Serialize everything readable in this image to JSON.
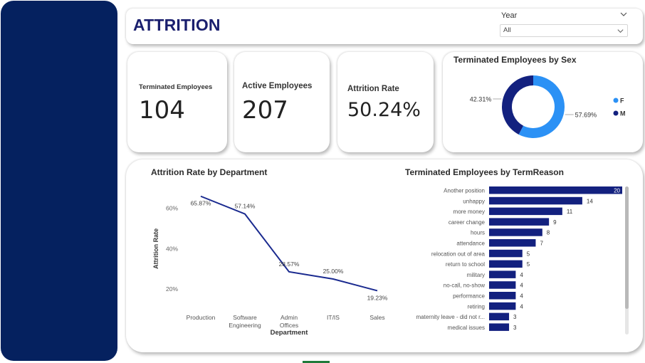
{
  "header": {
    "title": "ATTRITION",
    "slicer_label": "Year",
    "slicer_value": "All"
  },
  "kpis": [
    {
      "label": "Terminated Employees",
      "value": "104"
    },
    {
      "label": "Active Employees",
      "value": "207"
    },
    {
      "label": "Attrition Rate",
      "value": "50.24%"
    }
  ],
  "colors": {
    "sidebar": "#05215f",
    "accent_dark": "#13217f",
    "accent_light": "#2b91f5"
  },
  "chart_data": [
    {
      "type": "pie",
      "title": "Terminated Employees by Sex",
      "categories": [
        "F",
        "M"
      ],
      "values": [
        57.69,
        42.31
      ],
      "labels": [
        "57.69%",
        "42.31%"
      ],
      "colors": [
        "#2b91f5",
        "#13217f"
      ],
      "legend": "right"
    },
    {
      "type": "line",
      "title": "Attrition Rate by Department",
      "xlabel": "Department",
      "ylabel": "Attrition Rate",
      "categories": [
        "Production",
        "Software Engineering",
        "Admin Offices",
        "IT/IS",
        "Sales"
      ],
      "values": [
        65.87,
        57.14,
        28.57,
        25.0,
        19.23
      ],
      "labels": [
        "65.87%",
        "57.14%",
        "28.57%",
        "25.00%",
        "19.23%"
      ],
      "yticks": [
        "20%",
        "40%",
        "60%"
      ],
      "ytick_values": [
        20,
        40,
        60
      ],
      "ylim": [
        12,
        70
      ],
      "grid": false
    },
    {
      "type": "bar",
      "orientation": "horizontal",
      "title": "Terminated Employees by TermReason",
      "categories": [
        "Another position",
        "unhappy",
        "more money",
        "career change",
        "hours",
        "attendance",
        "relocation out of area",
        "return to school",
        "military",
        "no-call, no-show",
        "performance",
        "retiring",
        "maternity leave - did not r...",
        "medical issues"
      ],
      "values": [
        20,
        14,
        11,
        9,
        8,
        7,
        5,
        5,
        4,
        4,
        4,
        4,
        3,
        3
      ],
      "xlim": [
        0,
        20
      ],
      "grid": false
    }
  ]
}
